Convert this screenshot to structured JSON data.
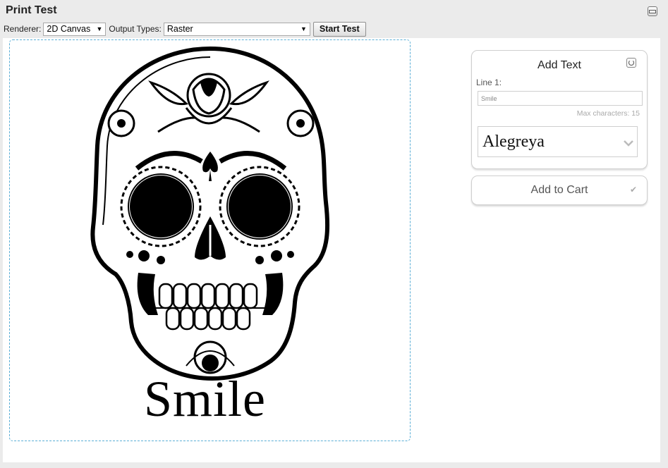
{
  "window": {
    "title": "Print Test"
  },
  "toolbar": {
    "renderer_label": "Renderer:",
    "renderer_value": "2D Canvas",
    "output_label": "Output Types:",
    "output_value": "Raster",
    "start_label": "Start Test"
  },
  "preview": {
    "text": "Smile"
  },
  "panel": {
    "title": "Add Text",
    "line1_label": "Line 1:",
    "line1_value": "Smile",
    "max_chars": "Max characters: 15",
    "font_value": "Alegreya"
  },
  "cart": {
    "label": "Add to Cart"
  },
  "icons": {
    "collapse": "collapse-icon",
    "reset": "reset-icon",
    "chevron": "chevron-down-icon",
    "check": "check-icon"
  }
}
